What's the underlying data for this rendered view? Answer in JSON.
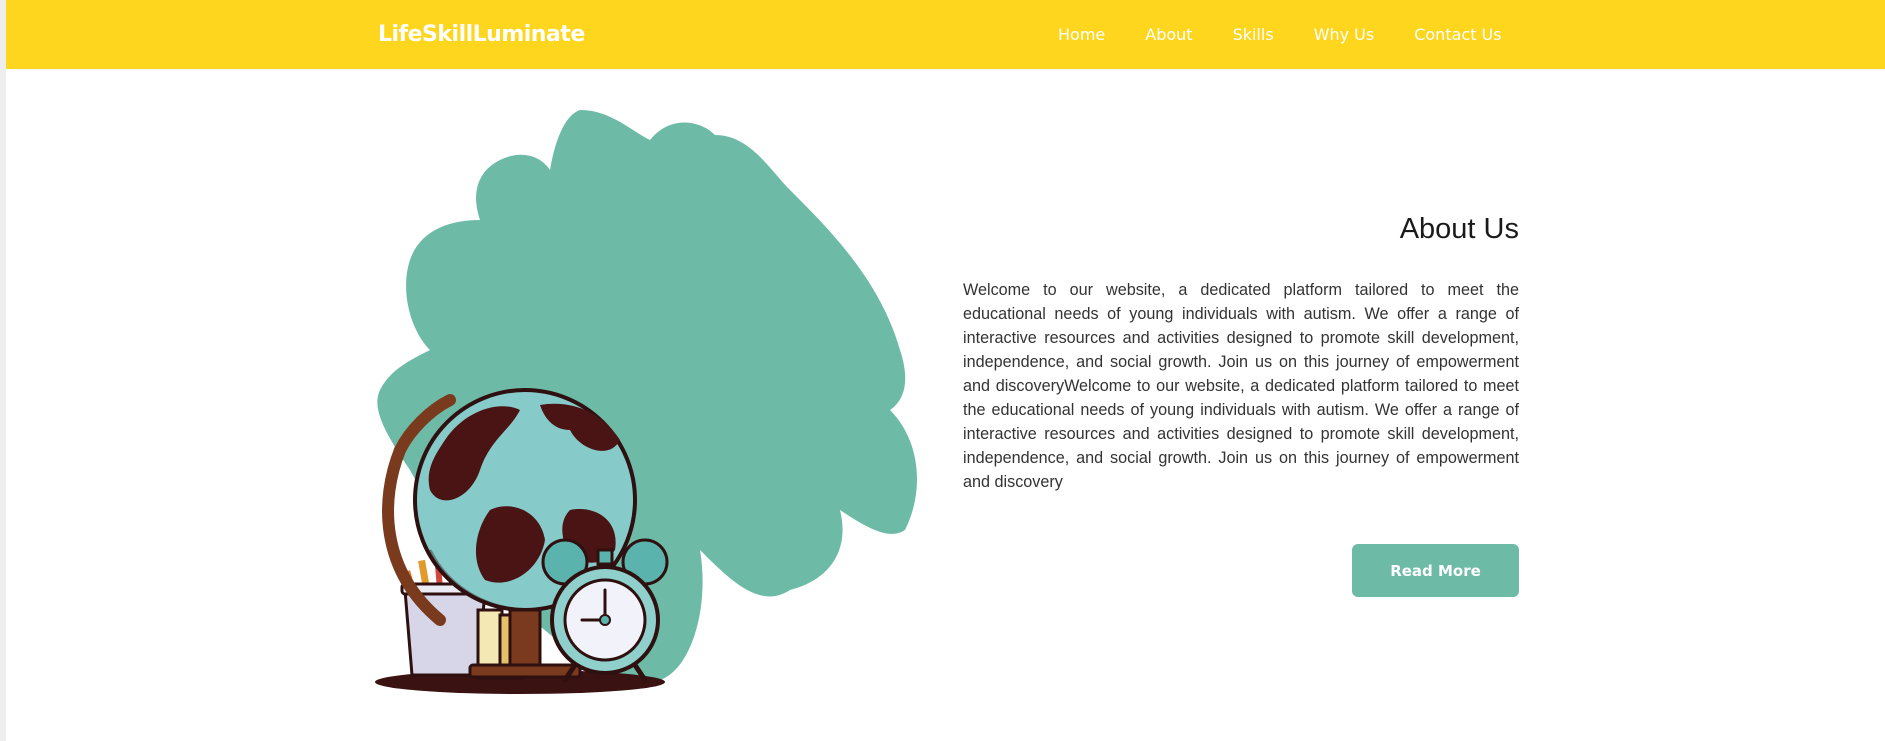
{
  "navbar": {
    "brand": "LifeSkillLuminate",
    "links": [
      "Home",
      "About",
      "Skills",
      "Why Us",
      "Contact Us"
    ]
  },
  "about": {
    "title": "About Us",
    "paragraph": "Welcome to our website, a dedicated platform tailored to meet the educational needs of young individuals with autism. We offer a range of interactive resources and activities designed to promote skill development, independence, and social growth. Join us on this journey of empowerment and discoveryWelcome to our website, a dedicated platform tailored to meet the educational needs of young individuals with autism. We offer a range of interactive resources and activities designed to promote skill development, independence, and social growth. Join us on this journey of empowerment and discovery",
    "button": "Read More"
  },
  "illustration": {
    "icons": [
      "blob-shape",
      "globe-icon",
      "alarm-clock-icon",
      "pencil-cup-icon",
      "books-icon"
    ]
  },
  "colors": {
    "navbar": "#fed61e",
    "accent": "#6dbba6",
    "blob": "#6dbba6"
  }
}
